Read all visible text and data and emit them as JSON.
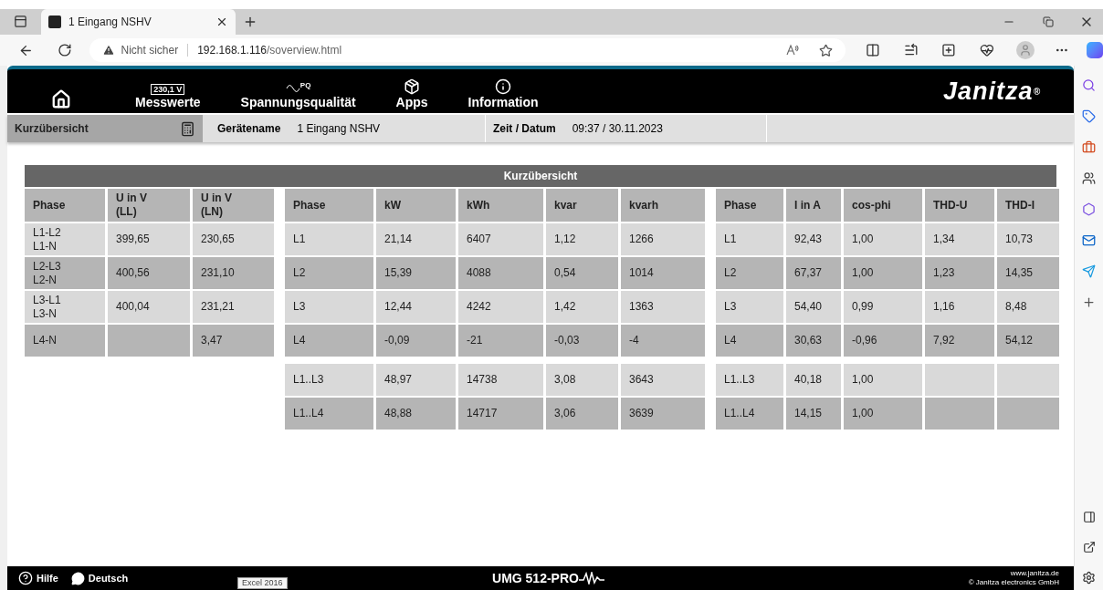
{
  "browser": {
    "tab_title": "1 Eingang NSHV",
    "security": "Nicht sicher",
    "url_host": "192.168.1.116",
    "url_path": "/soverview.html"
  },
  "nav": {
    "items": [
      {
        "kind": "home"
      },
      {
        "kind": "meter",
        "label": "Messwerte",
        "badge": "230,1 V"
      },
      {
        "kind": "wave",
        "label": "Spannungsqualität",
        "badge": "PQ"
      },
      {
        "kind": "box",
        "label": "Apps"
      },
      {
        "kind": "info",
        "label": "Information"
      }
    ],
    "logo": "Janitza",
    "logo_mark": "®"
  },
  "subheader": {
    "section": "Kurzübersicht",
    "device_label": "Gerätename",
    "device_value": "1 Eingang NSHV",
    "time_label": "Zeit / Datum",
    "time_value": "09:37 / 30.11.2023"
  },
  "table": {
    "title": "Kurzübersicht",
    "groups": [
      {
        "columns": [
          "Phase",
          "U in V\n(LL)",
          "U in V\n(LN)"
        ],
        "rows": [
          [
            "L1-L2\nL1-N",
            "399,65",
            "230,65"
          ],
          [
            "L2-L3\nL2-N",
            "400,56",
            "231,10"
          ],
          [
            "L3-L1\nL3-N",
            "400,04",
            "231,21"
          ],
          [
            "L4-N",
            null,
            "3,47"
          ]
        ]
      },
      {
        "columns": [
          "Phase",
          "kW",
          "kWh",
          "kvar",
          "kvarh"
        ],
        "rows": [
          [
            "L1",
            "21,14",
            "6407",
            "1,12",
            "1266"
          ],
          [
            "L2",
            "15,39",
            "4088",
            "0,54",
            "1014"
          ],
          [
            "L3",
            "12,44",
            "4242",
            "1,42",
            "1363"
          ],
          [
            "L4",
            "-0,09",
            "-21",
            "-0,03",
            "-4"
          ]
        ],
        "totals": [
          [
            "L1..L3",
            "48,97",
            "14738",
            "3,08",
            "3643"
          ],
          [
            "L1..L4",
            "48,88",
            "14717",
            "3,06",
            "3639"
          ]
        ]
      },
      {
        "columns": [
          "Phase",
          "I in A",
          "cos-phi",
          "THD-U",
          "THD-I"
        ],
        "rows": [
          [
            "L1",
            "92,43",
            "1,00",
            "1,34",
            "10,73"
          ],
          [
            "L2",
            "67,37",
            "1,00",
            "1,23",
            "14,35"
          ],
          [
            "L3",
            "54,40",
            "0,99",
            "1,16",
            "8,48"
          ],
          [
            "L4",
            "30,63",
            "-0,96",
            "7,92",
            "54,12"
          ]
        ],
        "totals": [
          [
            "L1..L3",
            "40,18",
            "1,00"
          ],
          [
            "L1..L4",
            "14,15",
            "1,00"
          ]
        ]
      }
    ]
  },
  "footer": {
    "help": "Hilfe",
    "language": "Deutsch",
    "model": "UMG 512-PRO",
    "site": "www.janitza.de",
    "copyright": "© Janitza electronics GmbH",
    "tooltip": "Excel 2016"
  }
}
